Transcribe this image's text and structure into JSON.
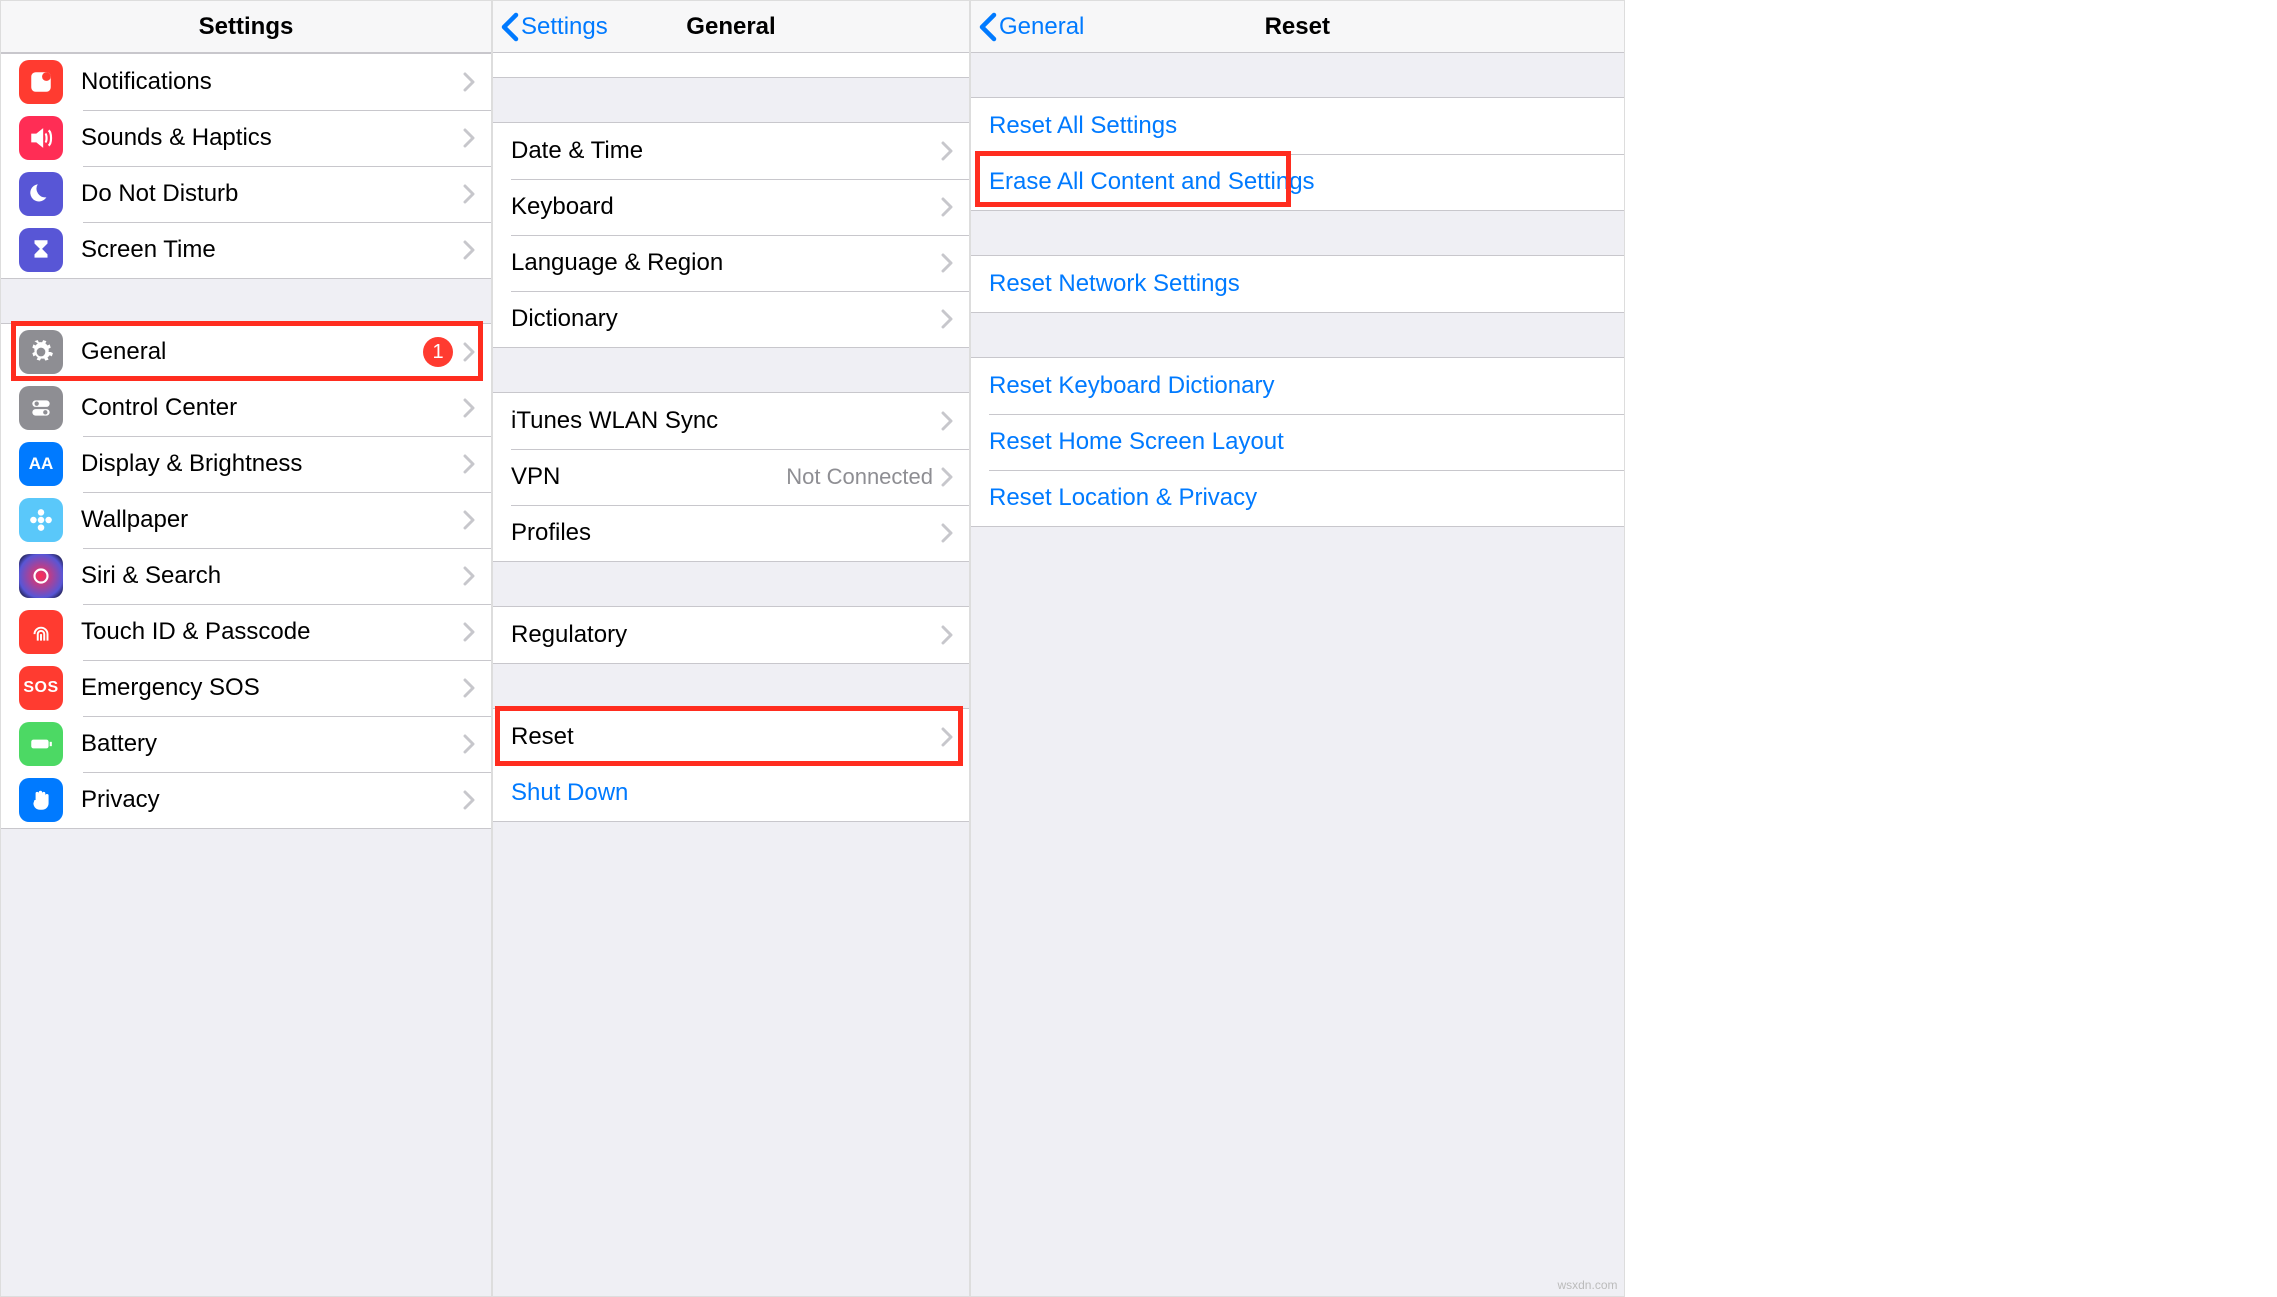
{
  "panel1": {
    "title": "Settings",
    "groups": [
      [
        {
          "icon": "notifications",
          "label": "Notifications"
        },
        {
          "icon": "sounds",
          "label": "Sounds & Haptics"
        },
        {
          "icon": "dnd",
          "label": "Do Not Disturb"
        },
        {
          "icon": "screentime",
          "label": "Screen Time"
        }
      ],
      [
        {
          "icon": "general",
          "label": "General",
          "badge": "1",
          "highlight": true
        },
        {
          "icon": "controlcenter",
          "label": "Control Center"
        },
        {
          "icon": "display",
          "label": "Display & Brightness"
        },
        {
          "icon": "wallpaper",
          "label": "Wallpaper"
        },
        {
          "icon": "siri",
          "label": "Siri & Search"
        },
        {
          "icon": "touchid",
          "label": "Touch ID & Passcode"
        },
        {
          "icon": "sos",
          "label": "Emergency SOS",
          "sosText": "SOS"
        },
        {
          "icon": "battery",
          "label": "Battery"
        },
        {
          "icon": "privacy",
          "label": "Privacy"
        }
      ]
    ]
  },
  "panel2": {
    "back": "Settings",
    "title": "General",
    "groups": [
      [
        {
          "label": "Date & Time"
        },
        {
          "label": "Keyboard"
        },
        {
          "label": "Language & Region"
        },
        {
          "label": "Dictionary"
        }
      ],
      [
        {
          "label": "iTunes WLAN Sync"
        },
        {
          "label": "VPN",
          "detail": "Not Connected"
        },
        {
          "label": "Profiles"
        }
      ],
      [
        {
          "label": "Regulatory"
        }
      ],
      [
        {
          "label": "Reset",
          "highlight": true
        },
        {
          "label": "Shut Down",
          "link": true,
          "noChevron": true
        }
      ]
    ]
  },
  "panel3": {
    "back": "General",
    "title": "Reset",
    "groups": [
      [
        {
          "label": "Reset All Settings"
        },
        {
          "label": "Erase All Content and Settings",
          "highlight": true
        }
      ],
      [
        {
          "label": "Reset Network Settings"
        }
      ],
      [
        {
          "label": "Reset Keyboard Dictionary"
        },
        {
          "label": "Reset Home Screen Layout"
        },
        {
          "label": "Reset Location & Privacy"
        }
      ]
    ]
  },
  "watermark": "wsxdn.com"
}
